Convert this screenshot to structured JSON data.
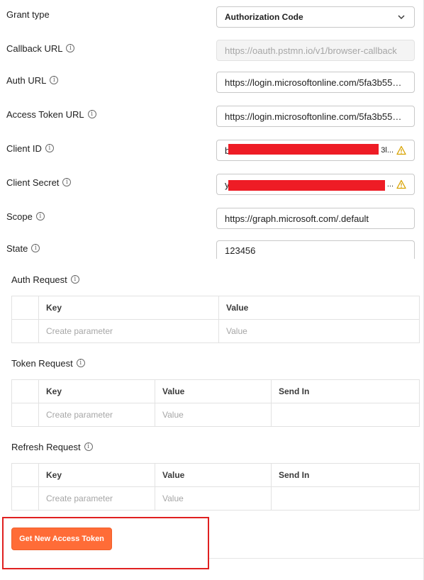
{
  "form": {
    "grant_type": {
      "label": "Grant type",
      "value": "Authorization Code"
    },
    "callback_url": {
      "label": "Callback URL",
      "value": "https://oauth.pstmn.io/v1/browser-callback"
    },
    "auth_url": {
      "label": "Auth URL",
      "value": "https://login.microsoftonline.com/5fa3b551 ..."
    },
    "access_token_url": {
      "label": "Access Token URL",
      "value": "https://login.microsoftonline.com/5fa3b551 ..."
    },
    "client_id": {
      "label": "Client ID",
      "value_start": "b",
      "value_end": "3l..."
    },
    "client_secret": {
      "label": "Client Secret",
      "value_start": "y",
      "value_end": "..."
    },
    "scope": {
      "label": "Scope",
      "value": "https://graph.microsoft.com/.default"
    },
    "state": {
      "label": "State",
      "value": "123456"
    }
  },
  "auth_request": {
    "label": "Auth Request",
    "headers": [
      "Key",
      "Value"
    ],
    "row": [
      "Create parameter",
      "Value"
    ]
  },
  "token_request": {
    "label": "Token Request",
    "headers": [
      "Key",
      "Value",
      "Send In"
    ],
    "row": [
      "Create parameter",
      "Value",
      ""
    ]
  },
  "refresh_request": {
    "label": "Refresh Request",
    "headers": [
      "Key",
      "Value",
      "Send In"
    ],
    "row": [
      "Create parameter",
      "Value",
      ""
    ]
  },
  "button": {
    "label": "Get New Access Token"
  },
  "colors": {
    "accent": "#ff6c37",
    "highlight": "#e02020",
    "redaction": "#ee1c25",
    "warning": "#d8a200"
  },
  "icons": {
    "info": "info-icon",
    "chevron": "chevron-down-icon",
    "warning": "warning-icon"
  }
}
